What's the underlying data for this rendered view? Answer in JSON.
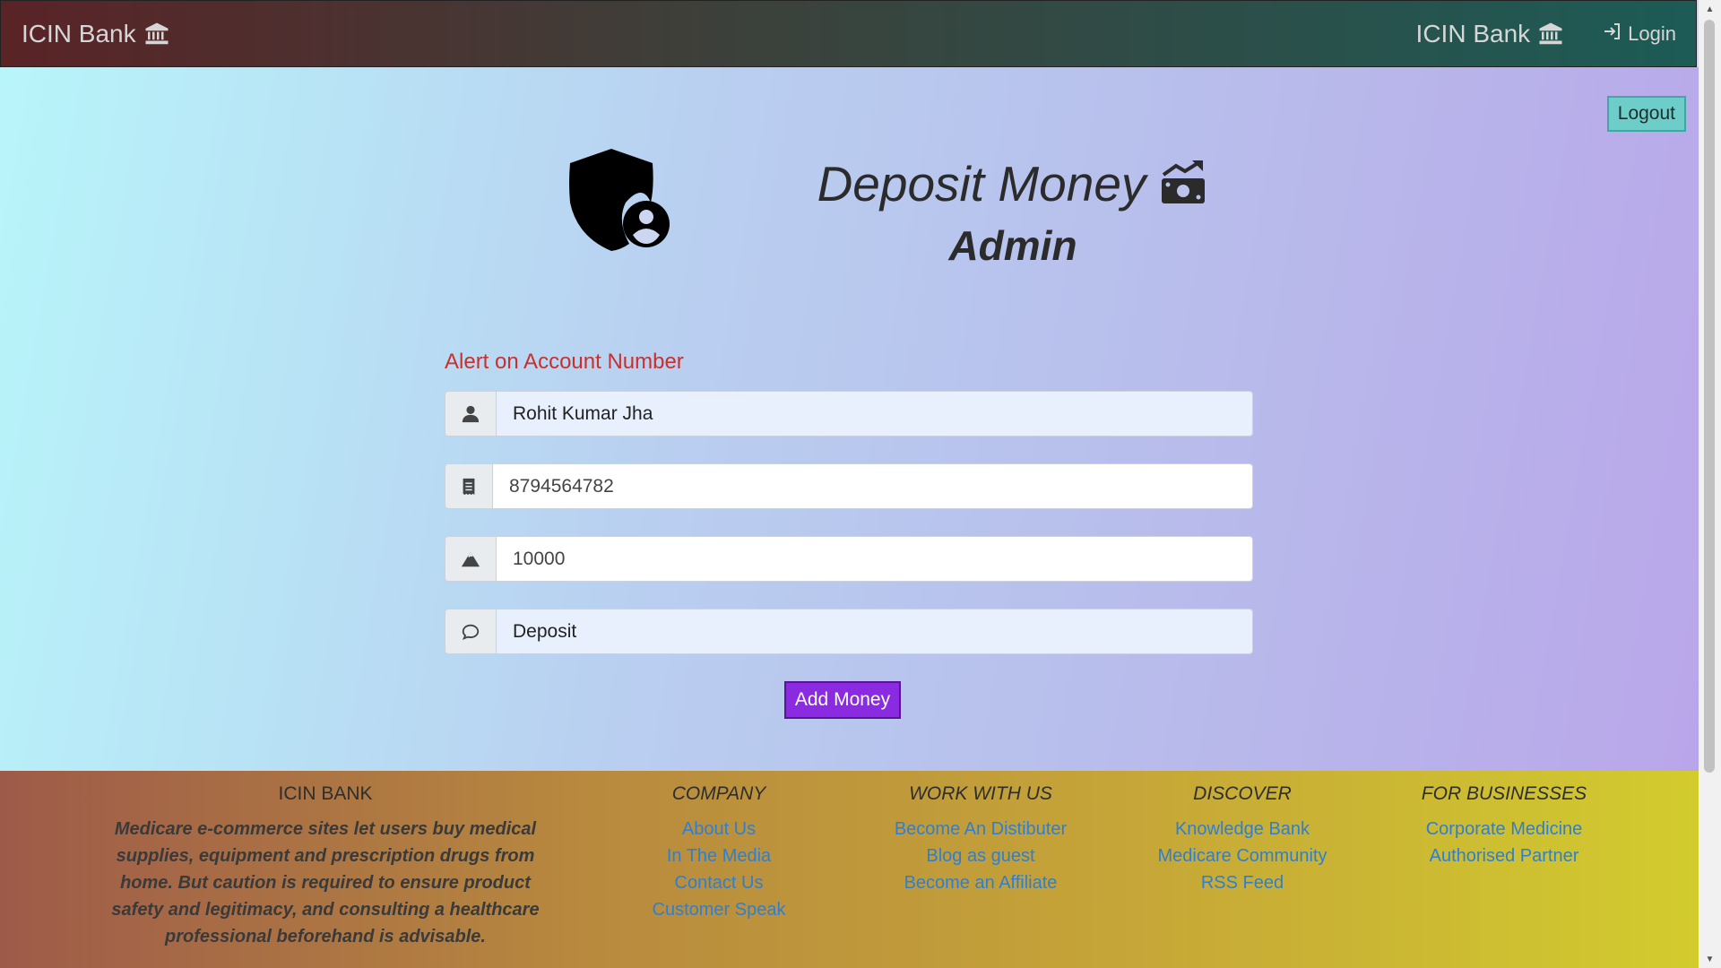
{
  "navbar": {
    "brand": "ICIN Bank",
    "brand_right": "ICIN Bank",
    "login": "Login"
  },
  "main": {
    "logout": "Logout",
    "title": "Deposit Money",
    "subtitle": "Admin",
    "alert": "Alert on Account Number",
    "fields": {
      "name": "Rohit Kumar Jha",
      "account": "8794564782",
      "amount": "10000",
      "remark": "Deposit"
    },
    "submit": "Add Money"
  },
  "footer": {
    "col1": {
      "heading": "ICIN BANK",
      "desc_lines": [
        "Medicare e-commerce sites let users buy medical",
        "supplies, equipment and prescription drugs from",
        "home. But caution is required to ensure product",
        "safety and legitimacy, and consulting a healthcare",
        "professional beforehand is advisable."
      ]
    },
    "company": {
      "heading": "COMPANY",
      "links": [
        "About Us",
        "In The Media",
        "Contact Us",
        "Customer Speak"
      ]
    },
    "work": {
      "heading": "WORK WITH US",
      "links": [
        "Become An Distibuter",
        "Blog as guest",
        "Become an Affiliate"
      ]
    },
    "discover": {
      "heading": "DISCOVER",
      "links": [
        "Knowledge Bank",
        "Medicare Community",
        "RSS Feed"
      ]
    },
    "business": {
      "heading": "FOR BUSINESSES",
      "links": [
        "Corporate Medicine",
        "Authorised Partner"
      ]
    }
  },
  "colors": {
    "accent_button": "#8a2be2",
    "logout_button": "#6ccdc9",
    "alert": "#c9302c",
    "link": "#2f7fd0"
  },
  "icons": [
    "bank-icon",
    "login-icon",
    "shield-user-icon",
    "money-chart-icon",
    "user-icon",
    "receipt-icon",
    "mountain-icon",
    "comment-icon"
  ]
}
